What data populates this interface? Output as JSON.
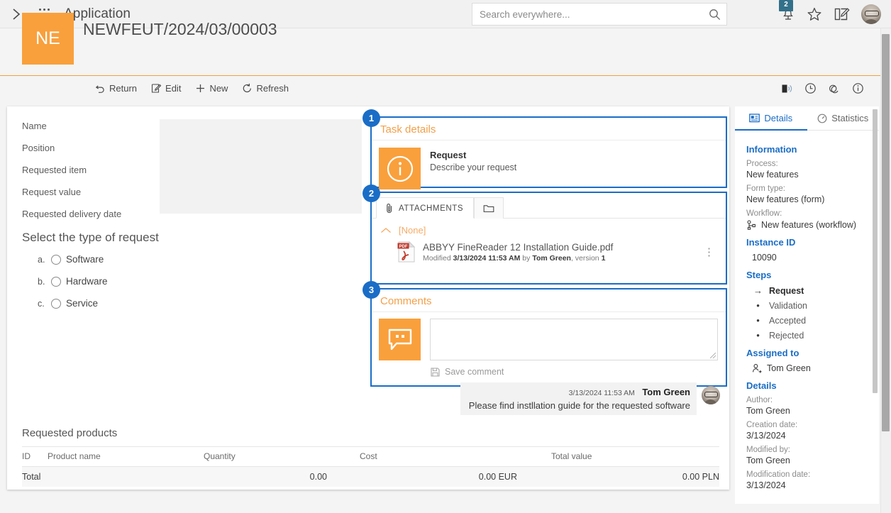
{
  "topbar": {
    "app_title": "Application",
    "expand_icon": "chevron-right-icon",
    "waffle_icon": "app-launcher-icon",
    "search_placeholder": "Search everywhere...",
    "search_value": "",
    "search_icon": "search-icon",
    "notifications_icon": "bell-icon",
    "notifications_count": "2",
    "favorites_icon": "star-icon",
    "notes_icon": "notes-edit-icon",
    "avatar_icon": "user-avatar"
  },
  "record": {
    "tile_initials": "NE",
    "title": "NEWFEUT/2024/03/00003"
  },
  "actionbar": {
    "items": [
      {
        "label": "Return",
        "icon": "undo-arrow-icon"
      },
      {
        "label": "Edit",
        "icon": "edit-pencil-icon"
      },
      {
        "label": "New",
        "icon": "plus-icon"
      },
      {
        "label": "Refresh",
        "icon": "refresh-circle-icon"
      }
    ],
    "tools": [
      {
        "icon": "read-aloud-icon"
      },
      {
        "icon": "history-clock-icon"
      },
      {
        "icon": "links-chain-icon"
      },
      {
        "icon": "info-circle-icon"
      }
    ]
  },
  "form": {
    "fields": [
      "Name",
      "Position",
      "Requested item",
      "Request value",
      "Requested delivery date"
    ],
    "section_title": "Select the type of request",
    "options": [
      {
        "letter": "a.",
        "label": "Software"
      },
      {
        "letter": "b.",
        "label": "Hardware"
      },
      {
        "letter": "c.",
        "label": "Service"
      }
    ]
  },
  "products": {
    "title": "Requested products",
    "columns": [
      "ID",
      "Product name",
      "Quantity",
      "Cost",
      "Total value"
    ],
    "total_row": {
      "label": "Total",
      "quantity": "0.00",
      "cost": "0.00 EUR",
      "total_value": "0.00 PLN"
    }
  },
  "panels": {
    "task": {
      "callout": "1",
      "header": "Task details",
      "icon": "info-circle-icon",
      "name": "Request",
      "description": "Describe your request"
    },
    "attachments": {
      "callout": "2",
      "tab_label": "ATTACHMENTS",
      "tab_icon": "paperclip-icon",
      "folder_tab_icon": "folder-icon",
      "group_label": "[None]",
      "group_chevron": "chevron-up-icon",
      "file": {
        "type_icon": "pdf-file-icon",
        "name": "ABBYY FineReader 12 Installation Guide.pdf",
        "meta_prefix": "Modified ",
        "meta_date": "3/13/2024 11:53 AM",
        "meta_by": " by ",
        "meta_author": "Tom Green",
        "meta_version_label": ", version ",
        "meta_version": "1",
        "menu_icon": "kebab-menu-icon"
      }
    },
    "comments": {
      "callout": "3",
      "header": "Comments",
      "icon": "comment-bubble-icon",
      "input_value": "",
      "save_label": "Save comment",
      "save_icon": "save-disk-icon",
      "items": [
        {
          "date": "3/13/2024 11:53 AM",
          "author": "Tom Green",
          "text": "Please find instllation guide for the requested software",
          "avatar": "user-avatar"
        }
      ]
    }
  },
  "sidebar": {
    "tabs": [
      {
        "label": "Details",
        "icon": "details-card-icon",
        "active": true
      },
      {
        "label": "Statistics",
        "icon": "gauge-icon",
        "active": false
      }
    ],
    "information_heading": "Information",
    "information": [
      {
        "label": "Process:",
        "value": "New features"
      },
      {
        "label": "Form type:",
        "value": "New features (form)"
      }
    ],
    "workflow_label": "Workflow:",
    "workflow_value": "New features (workflow)",
    "workflow_icon": "workflow-node-icon",
    "instance_heading": "Instance ID",
    "instance_id": "10090",
    "steps_heading": "Steps",
    "steps": [
      {
        "label": "Request",
        "marker": "arrow",
        "current": true
      },
      {
        "label": "Validation",
        "marker": "dot",
        "current": false
      },
      {
        "label": "Accepted",
        "marker": "dot",
        "current": false
      },
      {
        "label": "Rejected",
        "marker": "dot",
        "current": false
      }
    ],
    "assigned_heading": "Assigned to",
    "assigned_icon": "person-assign-icon",
    "assigned_to": "Tom Green",
    "details_heading": "Details",
    "details": [
      {
        "label": "Author:",
        "value": "Tom Green"
      },
      {
        "label": "Creation date:",
        "value": "3/13/2024"
      },
      {
        "label": "Modified by:",
        "value": "Tom Green"
      },
      {
        "label": "Modification date:",
        "value": "3/13/2024"
      }
    ]
  },
  "colors": {
    "accent_orange": "#f9a03c",
    "callout_blue": "#1a6dc6",
    "badge_teal": "#33708a",
    "link_blue": "#1a6dc6"
  }
}
